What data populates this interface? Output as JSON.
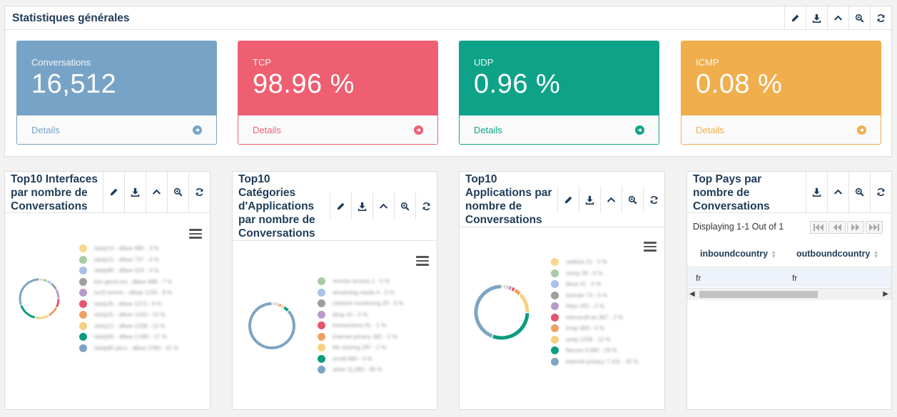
{
  "general": {
    "title": "Statistiques générales",
    "cards": [
      {
        "label": "Conversations",
        "value": "16,512",
        "footer": "Details",
        "color": "#77a3c6"
      },
      {
        "label": "TCP",
        "value": "98.96 %",
        "footer": "Details",
        "color": "#ed5f71"
      },
      {
        "label": "UDP",
        "value": "0.96 %",
        "footer": "Details",
        "color": "#0ea389"
      },
      {
        "label": "ICMP",
        "value": "0.08 %",
        "footer": "Details",
        "color": "#f0ae4c"
      }
    ]
  },
  "interfaces": {
    "title_line1": "Top10 Interfaces",
    "title_line2": "par nombre de",
    "title_line3": "Conversations",
    "legend": [
      {
        "label": "ixbdy10 - dlbee 680 - 3 %",
        "color": "#f7d88c"
      },
      {
        "label": "ixbdy21 - dlbee 737 - 4 %",
        "color": "#a9cba5"
      },
      {
        "label": "ixbdy80 - dlbee 524 - 4 %",
        "color": "#a9c2ea"
      },
      {
        "label": "lixe gwnd ext - dlbee 888 - 7 %",
        "color": "#9e9e9e"
      },
      {
        "label": "ixcl3 wrvrec - dlbee 1230 - 8 %",
        "color": "#b89ac8"
      },
      {
        "label": "ixbdy2k - dlbee 1373 - 8 %",
        "color": "#e6566b"
      },
      {
        "label": "ixbdy31 - dlbee 1420 - 10 %",
        "color": "#eca264"
      },
      {
        "label": "ixbdy21 - dlbee 1208 - 12 %",
        "color": "#f7d080"
      },
      {
        "label": "ixbdy60 - dlbee 2,080 - 17 %",
        "color": "#0c9c80"
      },
      {
        "label": "ixbdy80 pkcv - dlbee 3780 - 32 %",
        "color": "#7ea4c3"
      }
    ]
  },
  "categories": {
    "title_line1": "Top10",
    "title_line2": "Catégories",
    "title_line3": "d'Applications",
    "title_line4": "par nombre de",
    "title_line5": "Conversations",
    "legend": [
      {
        "label": "remote-access 1 - 0 %",
        "color": "#a9cba5"
      },
      {
        "label": "streaming media 4 - 0 %",
        "color": "#a9c2ea"
      },
      {
        "label": "network monitoring 20 - 0 %",
        "color": "#9e9e9e"
      },
      {
        "label": "bkup 41 - 0 %",
        "color": "#b89ac8"
      },
      {
        "label": "transactions 61 - 1 %",
        "color": "#e6566b"
      },
      {
        "label": "internet privacy 381 - 2 %",
        "color": "#eca264"
      },
      {
        "label": "file sharing 187 - 2 %",
        "color": "#f7d080"
      },
      {
        "label": "email 680 - 4 %",
        "color": "#0c9c80"
      },
      {
        "label": "other 11,680 - 86 %",
        "color": "#7ea4c3"
      }
    ]
  },
  "applications": {
    "title_line1": "Top10",
    "title_line2": "Applications par",
    "title_line3": "nombre de",
    "title_line4": "Conversations",
    "legend": [
      {
        "label": "netbios 21 - 0 %",
        "color": "#f7d88c"
      },
      {
        "label": "snmp 38 - 0 %",
        "color": "#a9cba5"
      },
      {
        "label": "bkup 41 - 0 %",
        "color": "#a9c2ea"
      },
      {
        "label": "domain 73 - 0 %",
        "color": "#9e9e9e"
      },
      {
        "label": "https 281 - 2 %",
        "color": "#b89ac8"
      },
      {
        "label": "microsoft-ds 387 - 2 %",
        "color": "#e6566b"
      },
      {
        "label": "imap 683 - 4 %",
        "color": "#eca264"
      },
      {
        "label": "smtp 1208 - 12 %",
        "color": "#f7d080"
      },
      {
        "label": "flacure 4,080 - 29 %",
        "color": "#0c9c80"
      },
      {
        "label": "internet privacy 7,101 - 42 %",
        "color": "#7ea4c3"
      }
    ]
  },
  "countries": {
    "title_line1": "Top Pays par",
    "title_line2": "nombre de",
    "title_line3": "Conversations",
    "info": "Displaying 1-1 Out of 1",
    "columns": [
      "inboundcountry",
      "outboundcountry"
    ],
    "rows": [
      [
        "fr",
        "fr"
      ]
    ]
  },
  "icons": [
    "pencil-icon",
    "download-icon",
    "chevron-up-icon",
    "zoom-icon",
    "refresh-icon",
    "hamburger-menu-icon",
    "arrow-circle-right-icon",
    "first-page-icon",
    "prev-page-icon",
    "next-page-icon",
    "last-page-icon"
  ]
}
